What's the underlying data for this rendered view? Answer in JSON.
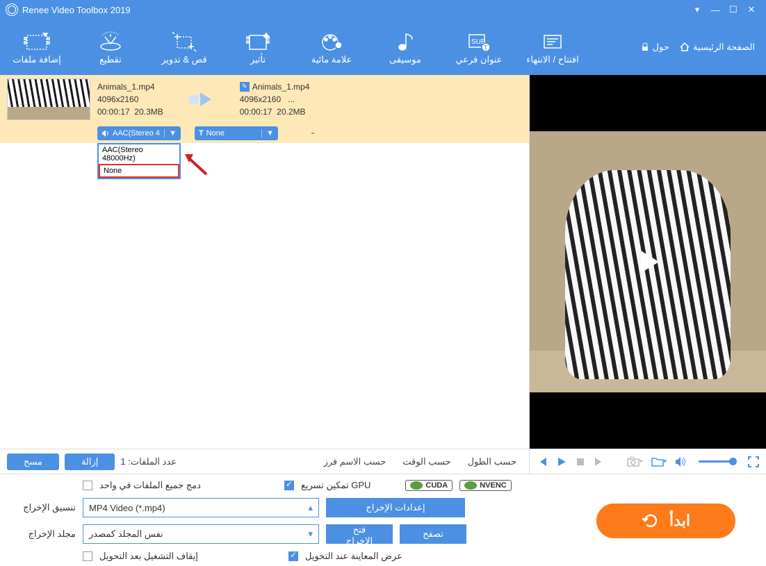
{
  "title": "Renee Video Toolbox 2019",
  "toolbar": [
    {
      "id": "add",
      "label": "إضافة ملفات"
    },
    {
      "id": "cut",
      "label": "تقطيع"
    },
    {
      "id": "crop",
      "label": "قص & تدوير"
    },
    {
      "id": "effect",
      "label": "تأثير"
    },
    {
      "id": "watermark",
      "label": "علامة مائية"
    },
    {
      "id": "music",
      "label": "موسيقى"
    },
    {
      "id": "subtitle",
      "label": "عنوان فرعي"
    },
    {
      "id": "intro",
      "label": "افتتاح / الانتهاء"
    }
  ],
  "header_links": {
    "about": "حول",
    "home": "الصفحة الرئيسية"
  },
  "file": {
    "src": {
      "name": "Animals_1.mp4",
      "res": "4096x2160",
      "dur": "00:00:17",
      "size": "20.3MB"
    },
    "out": {
      "name": "Animals_1.mp4",
      "res": "4096x2160",
      "more": "...",
      "dur": "00:00:17",
      "size": "20.2MB"
    },
    "audio_dd": "AAC(Stereo 4",
    "text_dd": "None",
    "popup_opt1": "AAC(Stereo 48000Hz)",
    "popup_opt2": "None",
    "dash": "-"
  },
  "sortbar": {
    "clear": "مسح",
    "remove": "إزالة",
    "count_label": "عدد الملفات:",
    "count": "1",
    "by_name": "حسب الاسم فرز",
    "by_time": "حسب الوقت",
    "by_length": "حسب الطول"
  },
  "bottom": {
    "merge": "دمج جميع الملفات في واحد",
    "gpu": "تمكين تسريع GPU",
    "cuda": "CUDA",
    "nvenc": "NVENC",
    "format_lbl": "تنسيق الإخراج",
    "format_val": "MP4 Video (*.mp4)",
    "out_settings": "إعدادات الإخراج",
    "folder_lbl": "مجلد الإخراج",
    "folder_val": "نفس المجلد كمصدر",
    "open_out": "فتح الإخراج",
    "browse": "تصفح",
    "stop_after": "إيقاف التشغيل بعد التحويل",
    "preview_after": "عرض المعاينة عند التحويل",
    "start": "ابدأ"
  }
}
